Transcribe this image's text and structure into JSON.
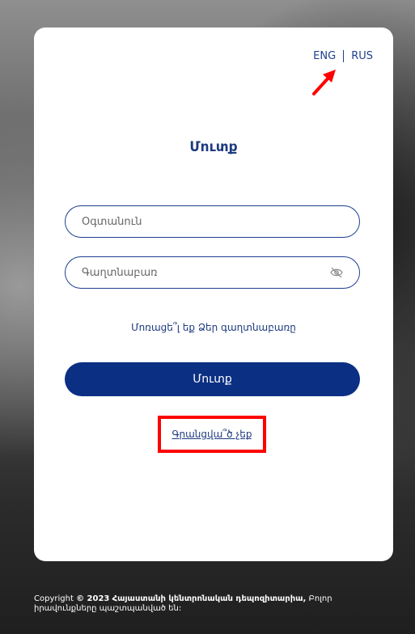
{
  "lang": {
    "eng": "ENG",
    "rus": "RUS"
  },
  "login": {
    "title": "Մուտք",
    "username_placeholder": "Օգտանուն",
    "password_placeholder": "Գաղտնաբառ",
    "forgot": "Մոռացե՞լ եք Ձեր գաղտնաբառը",
    "submit": "Մուտք",
    "register": "Գրանցվա՞ծ չեք"
  },
  "footer": {
    "copyright": "Copyright",
    "year": "© 2023",
    "org": "Հայաստանի կենտրոնական դեպոզիտարիա,",
    "rights": " Բոլոր իրավունքները պաշտպանված են:"
  },
  "colors": {
    "primary": "#0a2f83",
    "accent": "#1e3f8f",
    "highlight": "#ff0000"
  }
}
